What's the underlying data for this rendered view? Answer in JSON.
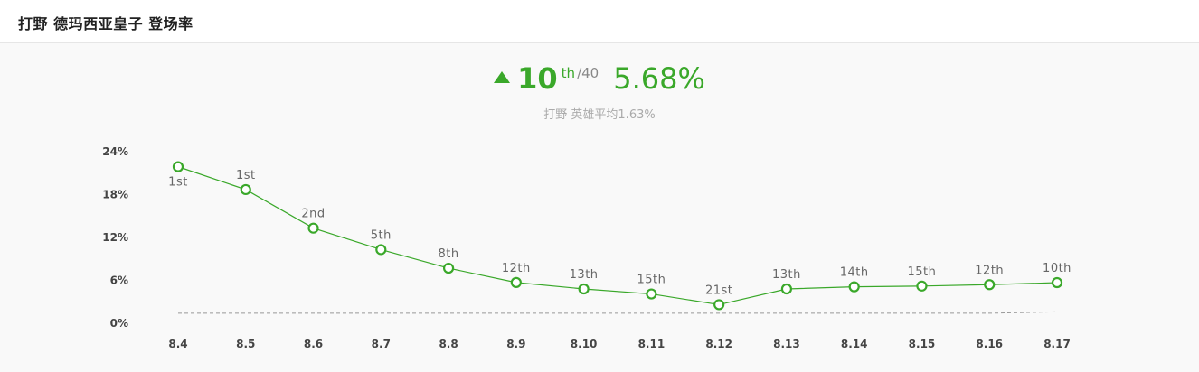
{
  "header": {
    "title": "打野 德玛西亚皇子 登场率"
  },
  "stats": {
    "trend_icon": "triangle-up-icon",
    "rank": "10",
    "rank_suffix": "th",
    "rank_total": "/40",
    "pick_rate": "5.68%",
    "role_average": "打野 英雄平均1.63%"
  },
  "colors": {
    "accent": "#3aa82a",
    "average_line": "#999999"
  },
  "chart_data": {
    "type": "line",
    "categories": [
      "8.4",
      "8.5",
      "8.6",
      "8.7",
      "8.8",
      "8.9",
      "8.10",
      "8.11",
      "8.12",
      "8.13",
      "8.14",
      "8.15",
      "8.16",
      "8.17"
    ],
    "values": [
      21.9,
      18.7,
      13.3,
      10.3,
      7.7,
      5.7,
      4.8,
      4.1,
      2.6,
      4.8,
      5.1,
      5.2,
      5.4,
      5.68
    ],
    "rank_labels": [
      "1st",
      "1st",
      "2nd",
      "5th",
      "8th",
      "12th",
      "13th",
      "15th",
      "21st",
      "13th",
      "14th",
      "15th",
      "12th",
      "10th"
    ],
    "average": [
      1.4,
      1.4,
      1.4,
      1.4,
      1.4,
      1.4,
      1.4,
      1.4,
      1.4,
      1.4,
      1.4,
      1.4,
      1.4,
      1.6
    ],
    "y_ticks": [
      "24%",
      "18%",
      "12%",
      "6%",
      "0%"
    ],
    "ylim": [
      0,
      24
    ],
    "grid": false,
    "legend": "none"
  }
}
